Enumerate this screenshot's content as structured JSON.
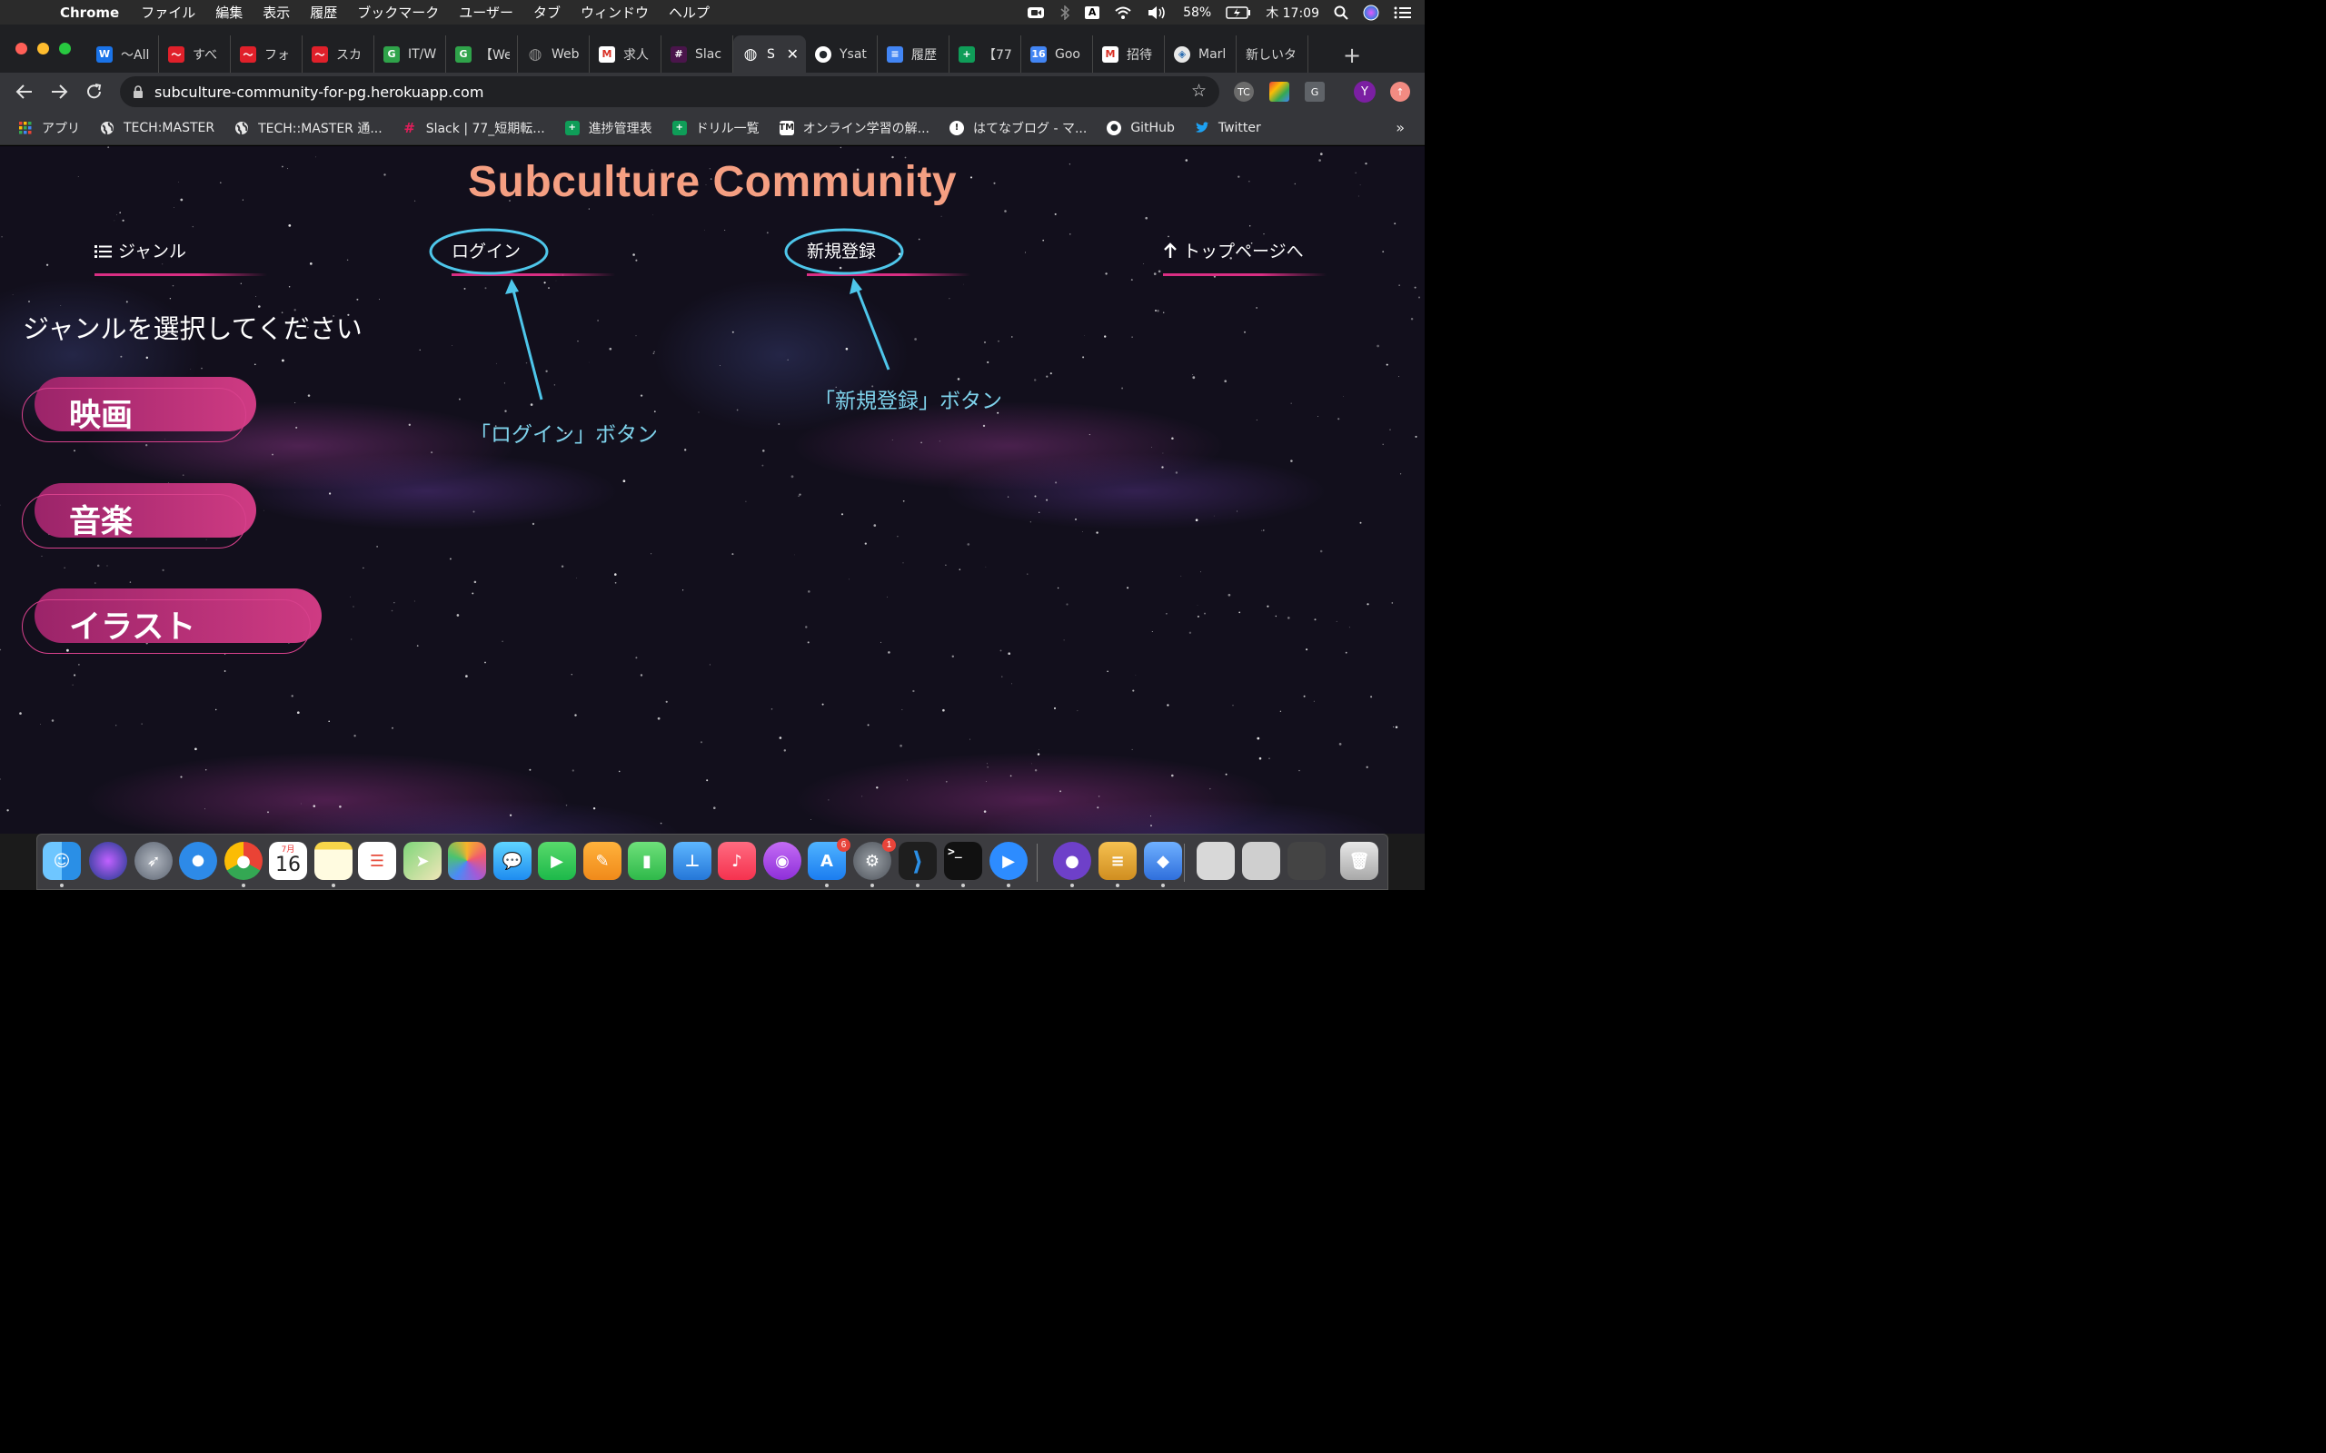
{
  "menubar": {
    "app_name": "Chrome",
    "menus": [
      "ファイル",
      "編集",
      "表示",
      "履歴",
      "ブックマーク",
      "ユーザー",
      "タブ",
      "ウィンドウ",
      "ヘルプ"
    ],
    "input_indicator": "A",
    "battery": "58%",
    "clock": "木 17:09"
  },
  "tabs": [
    {
      "title": "〜All",
      "icon": "wikipedia-icon",
      "color": "#1a73e8",
      "glyph": "W"
    },
    {
      "title": "すべ",
      "icon": "chart-app-icon",
      "color": "#e0202a",
      "glyph": "〜"
    },
    {
      "title": "フォ",
      "icon": "chart-app-icon",
      "color": "#e0202a",
      "glyph": "〜"
    },
    {
      "title": "スカ",
      "icon": "chart-app-icon",
      "color": "#e0202a",
      "glyph": "〜"
    },
    {
      "title": "IT/W",
      "icon": "g-logo-icon",
      "color": "#2fa34a",
      "glyph": "G"
    },
    {
      "title": "【We",
      "icon": "g-logo-icon",
      "color": "#2fa34a",
      "glyph": "G"
    },
    {
      "title": "Web",
      "icon": "globe-icon",
      "color": "#5f6368",
      "glyph": "◍"
    },
    {
      "title": "求人",
      "icon": "gmail-icon",
      "color": "#ffffff",
      "glyph": "M"
    },
    {
      "title": "Slac",
      "icon": "slack-icon",
      "color": "#4a154b",
      "glyph": "#"
    },
    {
      "title": "S",
      "icon": "globe-icon",
      "color": "#5f6368",
      "glyph": "◍",
      "active": true
    },
    {
      "title": "Ysat",
      "icon": "github-icon",
      "color": "#24292e",
      "glyph": "●"
    },
    {
      "title": "履歴",
      "icon": "docs-icon",
      "color": "#4285f4",
      "glyph": "≡"
    },
    {
      "title": "【77",
      "icon": "sheets-icon",
      "color": "#0f9d58",
      "glyph": "+"
    },
    {
      "title": "Goo",
      "icon": "calendar-icon",
      "color": "#4285f4",
      "glyph": "16"
    },
    {
      "title": "招待",
      "icon": "gmail-icon",
      "color": "#ffffff",
      "glyph": "M"
    },
    {
      "title": "Marl",
      "icon": "app-icon",
      "color": "#6b7b8c",
      "glyph": "◈"
    },
    {
      "title": "新しいタ",
      "icon": "none",
      "color": "transparent",
      "glyph": ""
    }
  ],
  "toolbar": {
    "url": "subculture-community-for-pg.herokuapp.com",
    "profile_initial": "Y",
    "ext_tc": "TC",
    "ext_g": "G"
  },
  "bookmarks": [
    {
      "label": "アプリ",
      "icon": "apps-grid-icon",
      "color": "#e8e8e8"
    },
    {
      "label": "TECH:MASTER",
      "icon": "globe-icon",
      "color": "#9aa0a6"
    },
    {
      "label": "TECH::MASTER 通...",
      "icon": "globe-icon",
      "color": "#9aa0a6"
    },
    {
      "label": "Slack | 77_短期転...",
      "icon": "slack-icon",
      "color": "#4a154b"
    },
    {
      "label": "進捗管理表",
      "icon": "sheets-icon",
      "color": "#0f9d58"
    },
    {
      "label": "ドリル一覧",
      "icon": "sheets-icon",
      "color": "#0f9d58"
    },
    {
      "label": "オンライン学習の解...",
      "icon": "tm-logo-icon",
      "color": "#ffffff"
    },
    {
      "label": "はてなブログ - マ...",
      "icon": "hatena-icon",
      "color": "#222222"
    },
    {
      "label": "GitHub",
      "icon": "github-icon",
      "color": "#24292e"
    },
    {
      "label": "Twitter",
      "icon": "twitter-icon",
      "color": "#1da1f2"
    }
  ],
  "page": {
    "title": "Subculture Community",
    "nav": {
      "genre": "ジャンル",
      "login": "ログイン",
      "signup": "新規登録",
      "top": "トップページへ"
    },
    "genre_heading": "ジャンルを選択してください",
    "genres": [
      "映画",
      "音楽",
      "イラスト"
    ],
    "annotations": {
      "login": "「ログイン」ボタン",
      "signup": "「新規登録」ボタン"
    }
  },
  "dock": {
    "calendar_month": "7月",
    "calendar_day": "16",
    "appstore_badge": "6",
    "prefs_badge": "1"
  },
  "colors": {
    "title": "#f59f82",
    "accent_pink": "#d92e83",
    "annotation_blue": "#7fd3ec",
    "annotation_ring": "#4ec6ea"
  }
}
